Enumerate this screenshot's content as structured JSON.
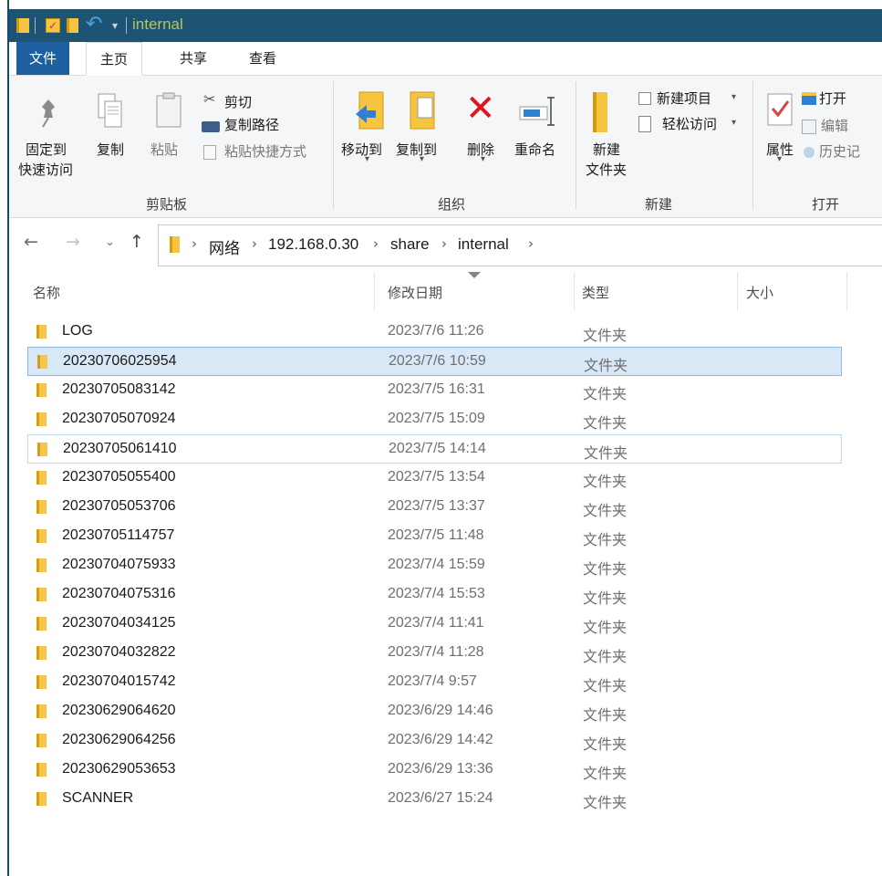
{
  "window": {
    "title": "internal"
  },
  "tabs": [
    {
      "label": "文件"
    },
    {
      "label": "主页"
    },
    {
      "label": "共享"
    },
    {
      "label": "查看"
    }
  ],
  "ribbon": {
    "clipboard": {
      "label": "剪贴板",
      "pin_l1": "固定到",
      "pin_l2": "快速访问",
      "copy": "复制",
      "paste": "粘贴",
      "cut": "剪切",
      "copy_path": "复制路径",
      "paste_shortcut": "粘贴快捷方式"
    },
    "organize": {
      "label": "组织",
      "move_to": "移动到",
      "copy_to": "复制到",
      "delete": "删除",
      "rename": "重命名"
    },
    "new": {
      "label": "新建",
      "new_folder_l1": "新建",
      "new_folder_l2": "文件夹",
      "new_item": "新建项目",
      "easy_access": "轻松访问"
    },
    "open": {
      "label": "打开",
      "properties": "属性",
      "open": "打开",
      "edit": "编辑",
      "history": "历史记"
    }
  },
  "address": {
    "crumbs": [
      "网络",
      "192.168.0.30",
      "share",
      "internal"
    ]
  },
  "columns": {
    "name": "名称",
    "date": "修改日期",
    "type": "类型",
    "size": "大小"
  },
  "files": [
    {
      "name": "LOG",
      "date": "2023/7/6 11:26",
      "type": "文件夹"
    },
    {
      "name": "20230706025954",
      "date": "2023/7/6 10:59",
      "type": "文件夹"
    },
    {
      "name": "20230705083142",
      "date": "2023/7/5 16:31",
      "type": "文件夹"
    },
    {
      "name": "20230705070924",
      "date": "2023/7/5 15:09",
      "type": "文件夹"
    },
    {
      "name": "20230705061410",
      "date": "2023/7/5 14:14",
      "type": "文件夹"
    },
    {
      "name": "20230705055400",
      "date": "2023/7/5 13:54",
      "type": "文件夹"
    },
    {
      "name": "20230705053706",
      "date": "2023/7/5 13:37",
      "type": "文件夹"
    },
    {
      "name": "20230705114757",
      "date": "2023/7/5 11:48",
      "type": "文件夹"
    },
    {
      "name": "20230704075933",
      "date": "2023/7/4 15:59",
      "type": "文件夹"
    },
    {
      "name": "20230704075316",
      "date": "2023/7/4 15:53",
      "type": "文件夹"
    },
    {
      "name": "20230704034125",
      "date": "2023/7/4 11:41",
      "type": "文件夹"
    },
    {
      "name": "20230704032822",
      "date": "2023/7/4 11:28",
      "type": "文件夹"
    },
    {
      "name": "20230704015742",
      "date": "2023/7/4 9:57",
      "type": "文件夹"
    },
    {
      "name": "20230629064620",
      "date": "2023/6/29 14:46",
      "type": "文件夹"
    },
    {
      "name": "20230629064256",
      "date": "2023/6/29 14:42",
      "type": "文件夹"
    },
    {
      "name": "20230629053653",
      "date": "2023/6/29 13:36",
      "type": "文件夹"
    },
    {
      "name": "SCANNER",
      "date": "2023/6/27 15:24",
      "type": "文件夹"
    }
  ]
}
